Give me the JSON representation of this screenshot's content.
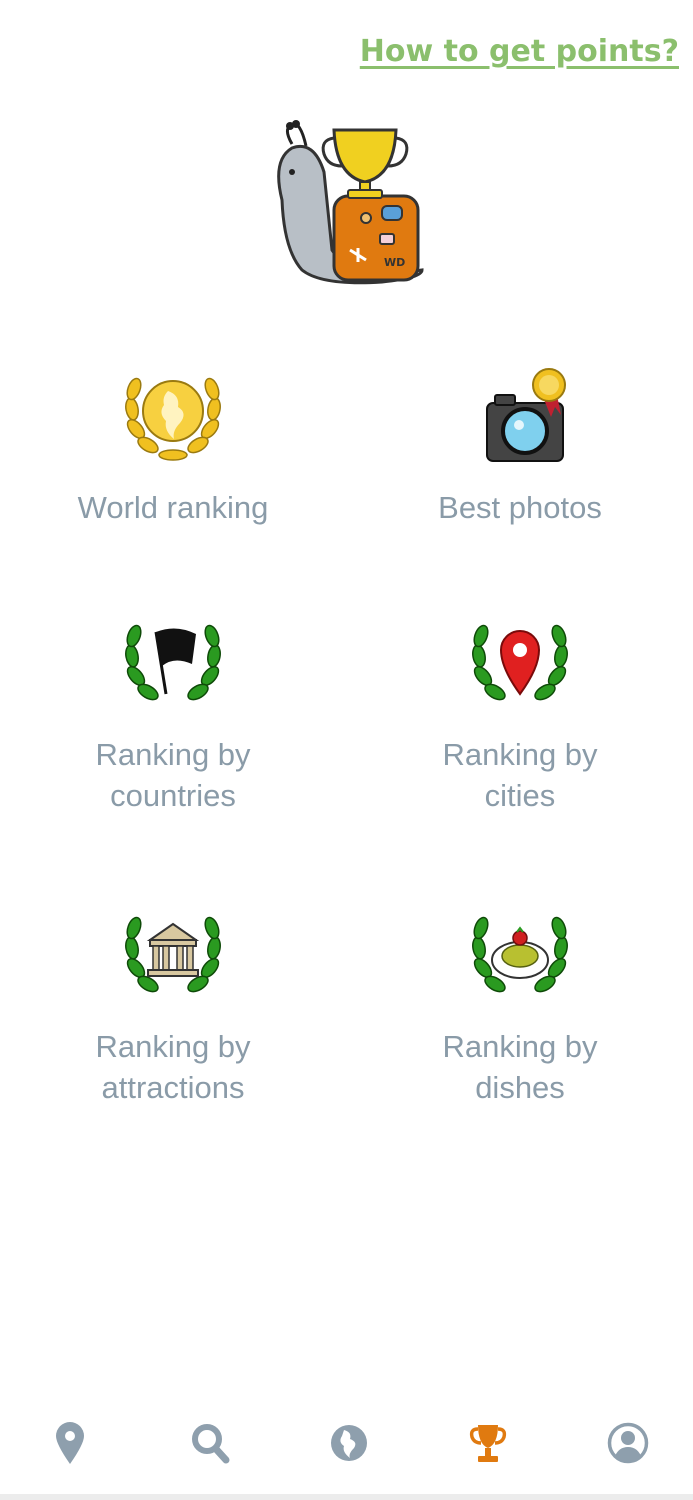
{
  "header": {
    "help_link": "How to get points?"
  },
  "colors": {
    "accent": "#e07a10",
    "link": "#8bbf6d",
    "label": "#8a9ba8",
    "tab_inactive": "#8e9fad"
  },
  "menu": {
    "items": [
      {
        "label": "World ranking",
        "icon": "globe-laurel-icon"
      },
      {
        "label": "Best photos",
        "icon": "camera-medal-icon"
      },
      {
        "label": "Ranking by countries",
        "icon": "flag-laurel-icon"
      },
      {
        "label": "Ranking by cities",
        "icon": "map-pin-laurel-icon"
      },
      {
        "label": "Ranking by attractions",
        "icon": "temple-laurel-icon"
      },
      {
        "label": "Ranking by dishes",
        "icon": "dish-laurel-icon"
      }
    ]
  },
  "tabs": [
    {
      "icon": "location-pin-icon",
      "active": false
    },
    {
      "icon": "search-icon",
      "active": false
    },
    {
      "icon": "globe-icon",
      "active": false
    },
    {
      "icon": "trophy-icon",
      "active": true
    },
    {
      "icon": "profile-icon",
      "active": false
    }
  ]
}
